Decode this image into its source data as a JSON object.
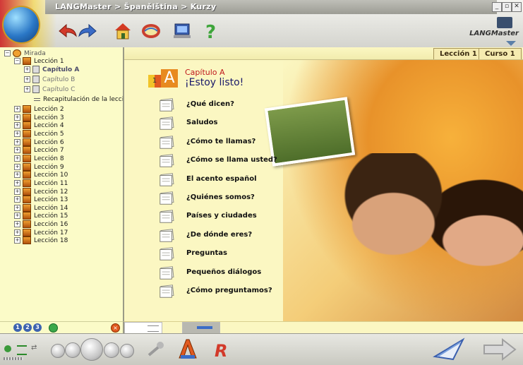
{
  "window": {
    "title": "LANGMaster > Španělština > Kurzy",
    "brand": "LANGMaster"
  },
  "tabs": [
    {
      "label": "Lección 1"
    },
    {
      "label": "Curso 1"
    }
  ],
  "tree": {
    "root": "Mirada",
    "lesson1": "Lección 1",
    "chapters": [
      "Capítulo A",
      "Capítulo B",
      "Capítulo C"
    ],
    "recap": "Recapitulación de la lección",
    "lessons": [
      "Lección 2",
      "Lección 3",
      "Lección 4",
      "Lección 5",
      "Lección 6",
      "Lección 7",
      "Lección 8",
      "Lección 9",
      "Lección 10",
      "Lección 11",
      "Lección 12",
      "Lección 13",
      "Lección 14",
      "Lección 15",
      "Lección 16",
      "Lección 17",
      "Lección 18"
    ],
    "levels": [
      "1",
      "2",
      "3"
    ]
  },
  "chapter": {
    "badge_number": "1",
    "badge_letter": "A",
    "label": "Capítulo A",
    "subtitle": "¡Estoy listo!"
  },
  "items": [
    "¿Qué dicen?",
    "Saludos",
    "¿Cómo te llamas?",
    "¿Cómo se llama usted?",
    "El acento español",
    "¿Quiénes somos?",
    "Países y ciudades",
    "¿De dónde eres?",
    "Preguntas",
    "Pequeños diálogos",
    "¿Cómo preguntamos?"
  ],
  "colors": {
    "tree_bg": "#fbfbc8",
    "main_bg": "#fbf7c2",
    "chapter_red": "#c0181c",
    "subtitle_blue": "#1a1a6a"
  }
}
